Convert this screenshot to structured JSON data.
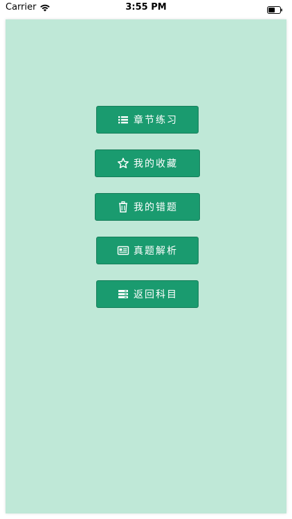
{
  "status_bar": {
    "carrier": "Carrier",
    "time": "3:55 PM"
  },
  "colors": {
    "panel_background": "#bfe8d7",
    "button_background": "#1a9b6f",
    "button_text": "#ffffff"
  },
  "menu": [
    {
      "label": "章节练习",
      "icon": "list-icon"
    },
    {
      "label": "我的收藏",
      "icon": "star-icon"
    },
    {
      "label": "我的错题",
      "icon": "trash-icon"
    },
    {
      "label": "真题解析",
      "icon": "newspaper-icon"
    },
    {
      "label": "返回科目",
      "icon": "stack-icon"
    }
  ]
}
